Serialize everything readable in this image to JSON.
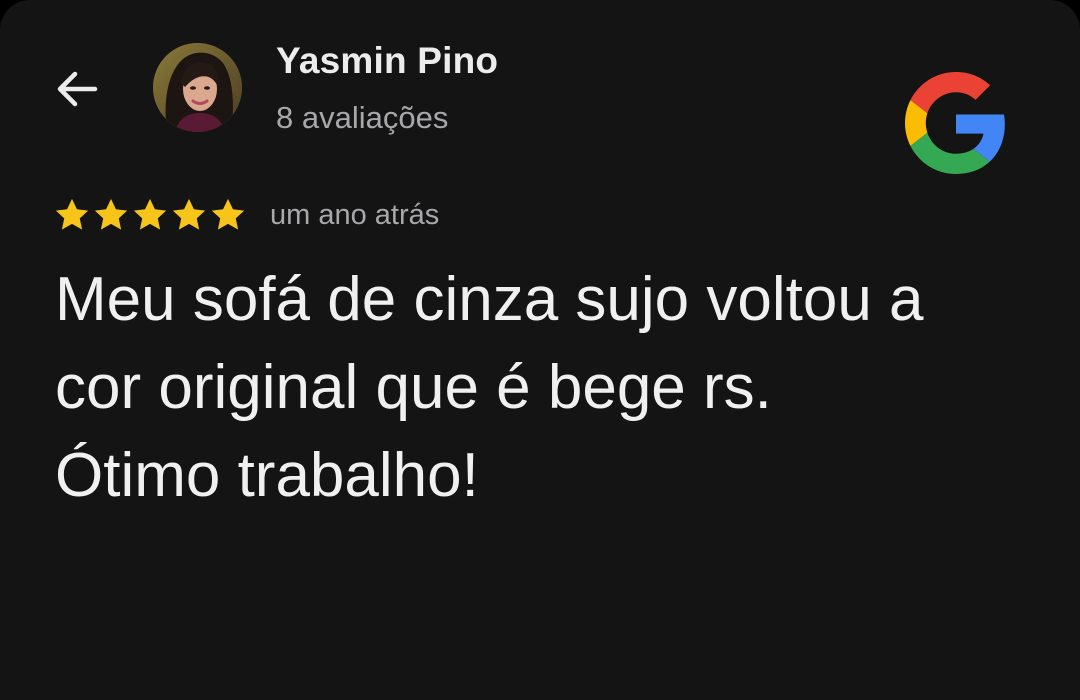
{
  "header": {
    "back_icon": "arrow-left-icon",
    "reviewer_name": "Yasmin Pino",
    "review_count": "8 avaliações",
    "brand_icon": "google-g-icon"
  },
  "review": {
    "rating": 5,
    "rating_max": 5,
    "star_color": "#f7c51a",
    "time_ago": "um ano atrás",
    "text": "Meu sofá de cinza sujo voltou a\ncor original que é bege rs.\nÓtimo trabalho!"
  },
  "colors": {
    "background": "#141414",
    "text_primary": "#f0f0f0",
    "text_secondary": "#a8a8ab",
    "google_red": "#ea4335",
    "google_yellow": "#fbbc05",
    "google_green": "#34a853",
    "google_blue": "#4285f4"
  }
}
